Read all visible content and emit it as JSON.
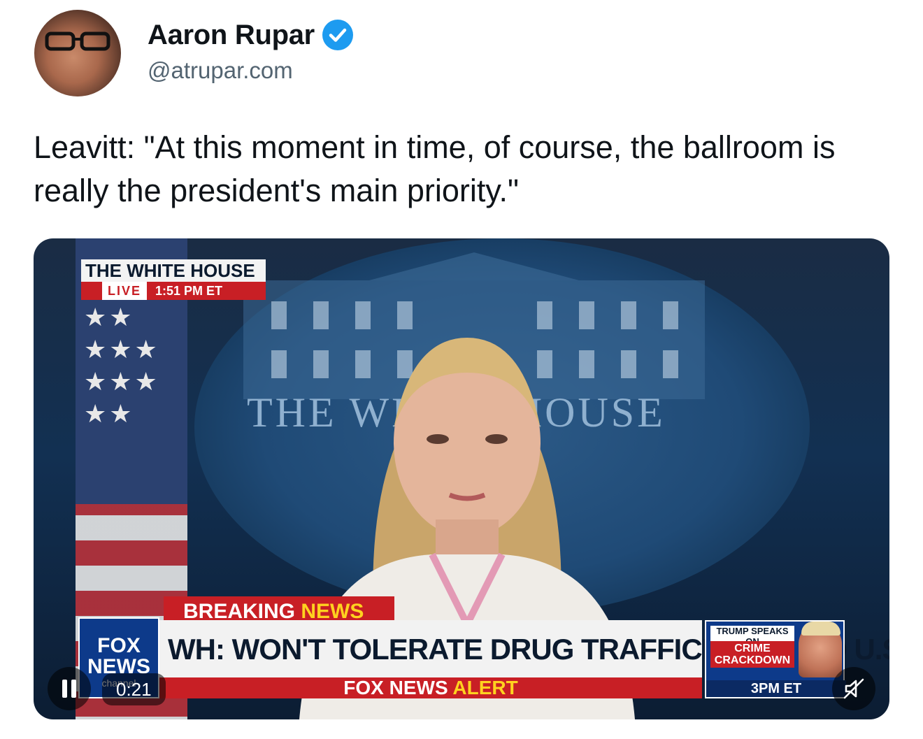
{
  "author": {
    "name": "Aaron Rupar",
    "handle": "@atrupar.com",
    "verified": true,
    "verified_color": "#1d9bf0"
  },
  "tweet": {
    "text": "Leavitt: \"At this moment in time, of course, the ballroom is really the president's main priority.\""
  },
  "video": {
    "overlay": {
      "location_bug": "THE WHITE HOUSE",
      "live_label": "LIVE",
      "time_label": "1:51 PM ET",
      "breaking_label_1": "BREAKING",
      "breaking_label_2": "NEWS",
      "headline": "WH: WON'T TOLERATE DRUG TRAFFICKING INTO U.S.",
      "alert_label_1": "FOX NEWS",
      "alert_label_2": "ALERT",
      "logo_text_1": "FOX",
      "logo_text_2": "NEWS",
      "logo_text_3": "channel",
      "promo_line_1": "TRUMP SPEAKS ON",
      "promo_line_2": "CRIME CRACKDOWN",
      "promo_time": "3PM ET",
      "seal_text": "THE WHITE HOUSE"
    },
    "controls": {
      "elapsed": "0:21",
      "state": "playing",
      "muted": true
    }
  },
  "colors": {
    "fox_red": "#c81f25",
    "fox_blue": "#0d3a8a",
    "fox_yellow": "#ffd21f"
  }
}
